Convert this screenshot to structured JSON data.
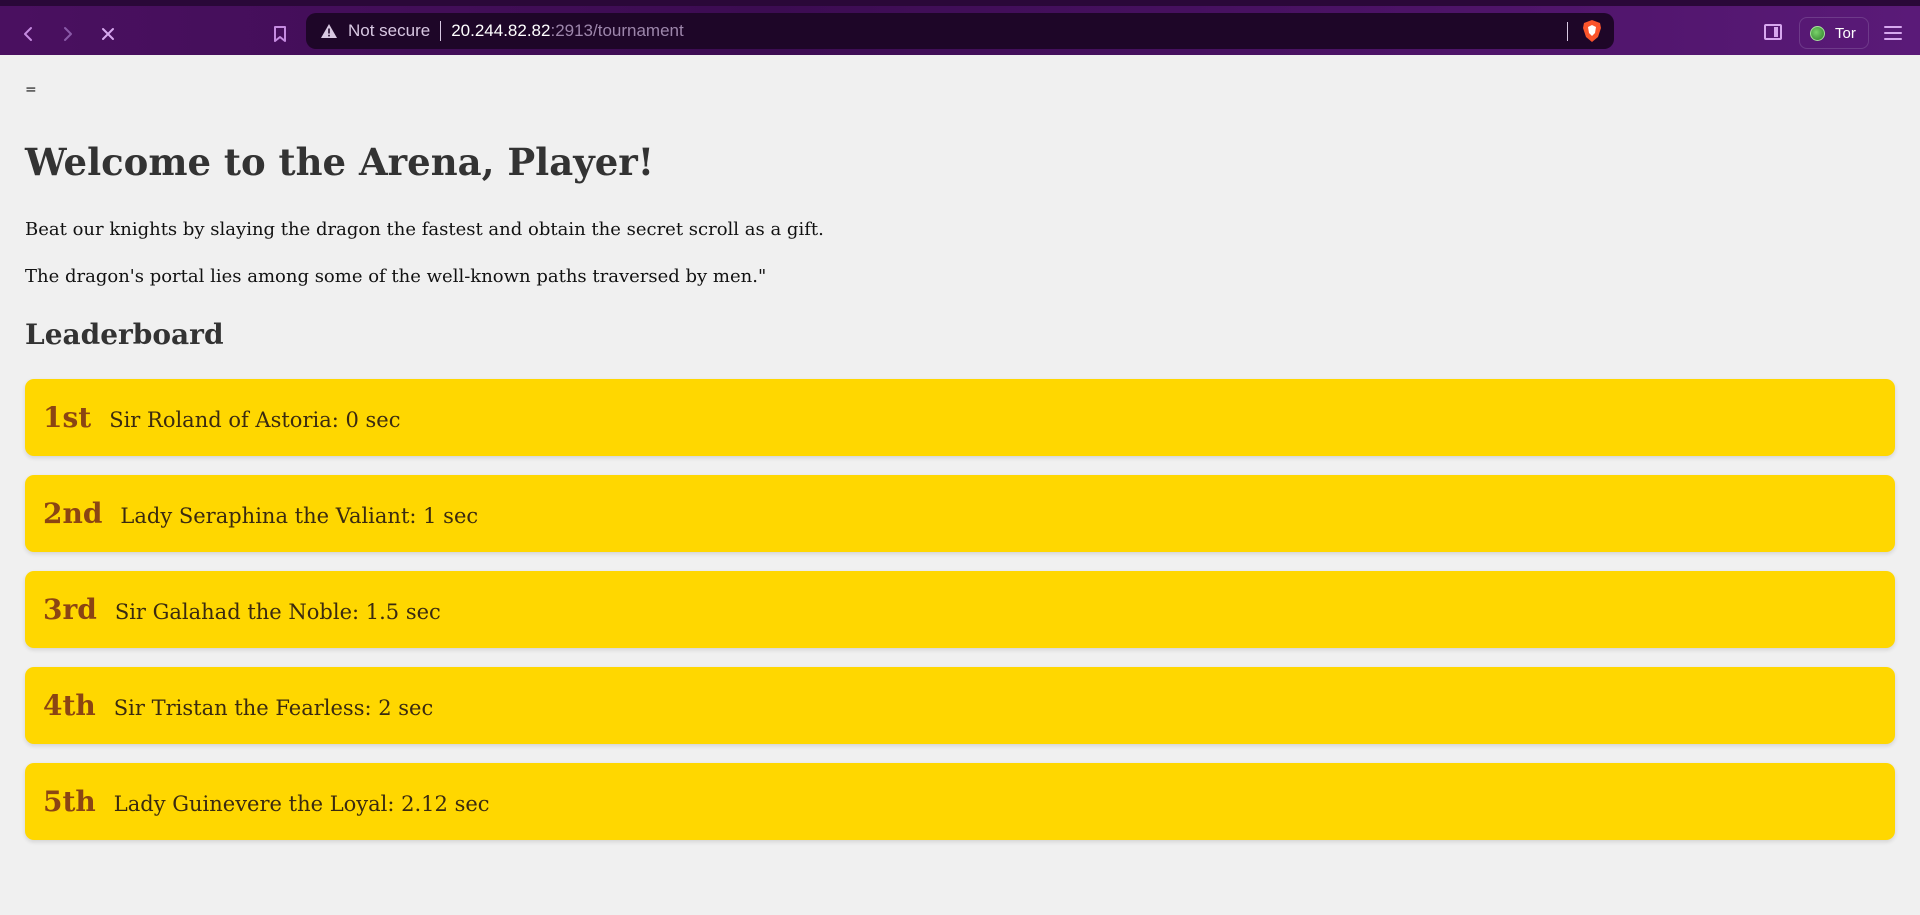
{
  "browser": {
    "url_warning": "Not secure",
    "url_host": "20.244.82.82",
    "url_path": ":2913/tournament",
    "tor_label": "Tor"
  },
  "page": {
    "stray_text": "=",
    "title": "Welcome to the Arena, Player!",
    "intro": "Beat our knights by slaying the dragon the fastest and obtain the secret scroll as a gift.",
    "hint": "The dragon's portal lies among some of the well-known paths traversed by men.\"",
    "leaderboard_title": "Leaderboard",
    "leaderboard": [
      {
        "rank": "1st",
        "entry": "Sir Roland of Astoria: 0 sec"
      },
      {
        "rank": "2nd",
        "entry": "Lady Seraphina the Valiant: 1 sec"
      },
      {
        "rank": "3rd",
        "entry": "Sir Galahad the Noble: 1.5 sec"
      },
      {
        "rank": "4th",
        "entry": "Sir Tristan the Fearless: 2 sec"
      },
      {
        "rank": "5th",
        "entry": "Lady Guinevere the Loyal: 2.12 sec"
      }
    ]
  },
  "colors": {
    "chrome_bg": "#3c0c52",
    "row_bg": "#ffd700",
    "rank_color": "#8b4513"
  }
}
